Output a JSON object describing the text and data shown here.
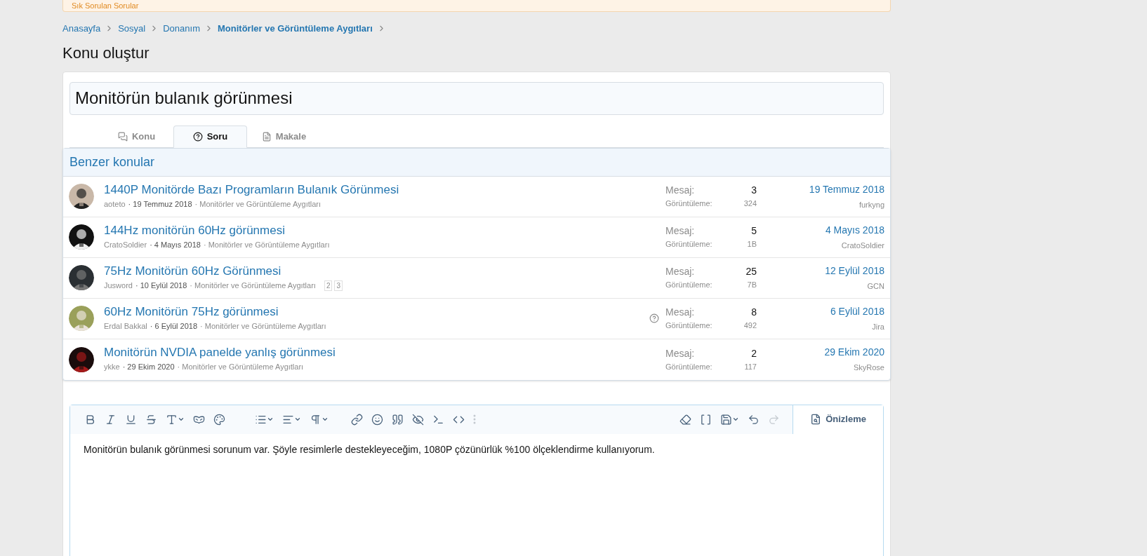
{
  "notice": {
    "text": "Sık Sorulan Sorular"
  },
  "breadcrumb": [
    {
      "label": "Anasayfa",
      "current": false
    },
    {
      "label": "Sosyal",
      "current": false
    },
    {
      "label": "Donanım",
      "current": false
    },
    {
      "label": "Monitörler ve Görüntüleme Aygıtları",
      "current": true
    }
  ],
  "page_title": "Konu oluştur",
  "title_field": {
    "value": "Monitörün bulanık görünmesi"
  },
  "tabs": [
    {
      "label": "Konu",
      "kind": "chat",
      "selected": false
    },
    {
      "label": "Soru",
      "kind": "question",
      "selected": true
    },
    {
      "label": "Makale",
      "kind": "doc",
      "selected": false
    }
  ],
  "similar": {
    "title": "Benzer konular",
    "rows": [
      {
        "title": "1440P Monitörde Bazı Programların Bulanık Görünmesi",
        "author": "aoteto",
        "date": "· 19 Temmuz 2018",
        "forum": "· Monitörler ve Görüntüleme Aygıtları",
        "question": false,
        "messages_label": "Mesaj:",
        "messages": "3",
        "views_label": "Görüntüleme:",
        "views": "324",
        "last_date": "19 Temmuz 2018",
        "last_user": "furkyng"
      },
      {
        "title": "144Hz monitörün 60Hz görünmesi",
        "author": "CratoSoldier",
        "date": "· 4 Mayıs 2018",
        "forum": "· Monitörler ve Görüntüleme Aygıtları",
        "question": false,
        "messages_label": "Mesaj:",
        "messages": "5",
        "views_label": "Görüntüleme:",
        "views": "1B",
        "last_date": "4 Mayıs 2018",
        "last_user": "CratoSoldier"
      },
      {
        "title": "75Hz Monitörün 60Hz Görünmesi",
        "author": "Jusword",
        "date": "· 10 Eylül 2018",
        "forum": "· Monitörler ve Görüntüleme Aygıtları",
        "pages": [
          "2",
          "3"
        ],
        "question": false,
        "messages_label": "Mesaj:",
        "messages": "25",
        "views_label": "Görüntüleme:",
        "views": "7B",
        "last_date": "12 Eylül 2018",
        "last_user": "GCN"
      },
      {
        "title": "60Hz Monitörün 75Hz görünmesi",
        "author": "Erdal Bakkal",
        "date": "· 6 Eylül 2018",
        "forum": "· Monitörler ve Görüntüleme Aygıtları",
        "question": true,
        "messages_label": "Mesaj:",
        "messages": "8",
        "views_label": "Görüntüleme:",
        "views": "492",
        "last_date": "6 Eylül 2018",
        "last_user": "Jira"
      },
      {
        "title": "Monitörün NVDIA panelde yanlış görünmesi",
        "author": "ykke",
        "date": "· 29 Ekim 2020",
        "forum": "· Monitörler ve Görüntüleme Aygıtları",
        "question": false,
        "messages_label": "Mesaj:",
        "messages": "2",
        "views_label": "Görüntüleme:",
        "views": "117",
        "last_date": "29 Ekim 2020",
        "last_user": "SkyRose"
      }
    ]
  },
  "editor": {
    "redo_disabled": true,
    "preview_label": "Önizleme",
    "body": "Monitörün bulanık görünmesi sorunum var. Şöyle resimlerle destekleyeceğim, 1080P çözünürlük %100 ölçeklendirme kullanıyorum."
  }
}
